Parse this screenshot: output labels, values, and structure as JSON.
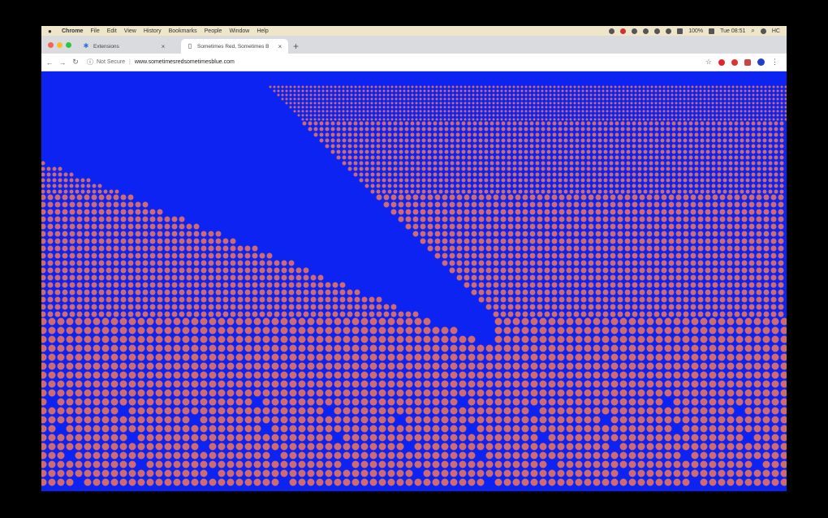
{
  "menubar": {
    "apple": "",
    "items": [
      "Chrome",
      "File",
      "Edit",
      "View",
      "History",
      "Bookmarks",
      "People",
      "Window",
      "Help"
    ],
    "battery": "100%",
    "clock": "Tue 08:51",
    "user": "HC"
  },
  "tabs": [
    {
      "title": "Extensions",
      "icon": "puzzle-icon"
    },
    {
      "title": "Sometimes Red, Sometimes B",
      "icon": "page-icon"
    }
  ],
  "toolbar": {
    "security_label": "Not Secure",
    "url": "www.sometimesredsometimesblue.com"
  },
  "page": {
    "background": "#0c23f2",
    "sprite_color": "#cf6b6e"
  }
}
